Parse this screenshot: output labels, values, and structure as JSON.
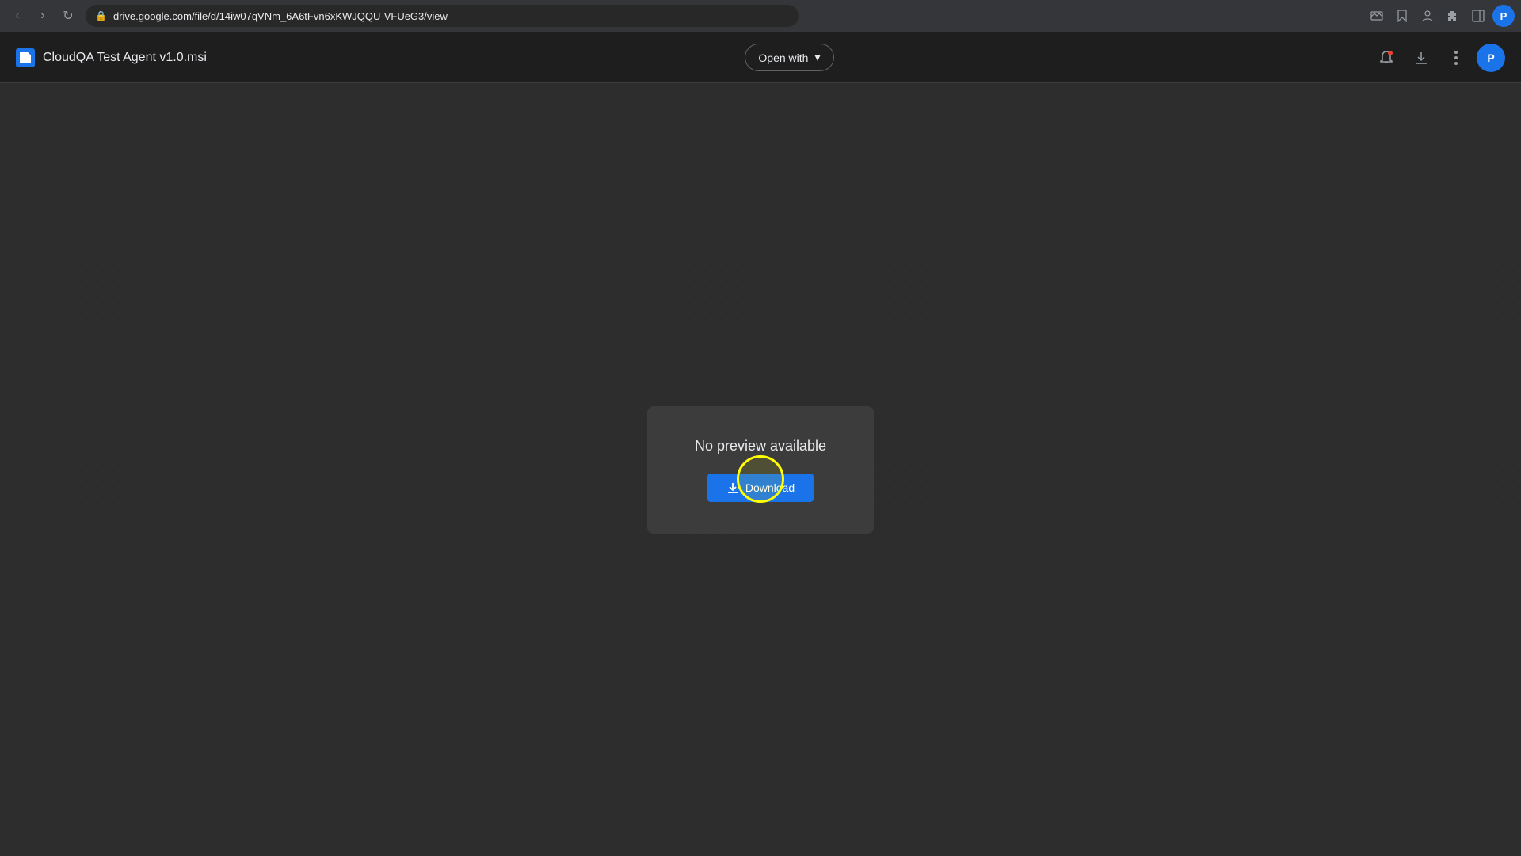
{
  "browser": {
    "url": "drive.google.com/file/d/14iw07qVNm_6A6tFvn6xKWJQQU-VFUeG3/view",
    "url_full": "drive.google.com/file/d/14iw07qVNm_6A6tFvn6xKWJQQU-VFUeG3/view",
    "back_btn_label": "‹",
    "forward_btn_label": "›",
    "refresh_btn_label": "↻",
    "profile_letter": "P"
  },
  "header": {
    "file_name": "CloudQA Test Agent v1.0.msi",
    "open_with_label": "Open with",
    "dropdown_arrow": "▾",
    "profile_letter": "P"
  },
  "main": {
    "no_preview_text": "No preview available",
    "download_label": "Download",
    "download_icon": "⬇"
  },
  "icons": {
    "lock": "🔒",
    "bell": "🔔",
    "download": "⬇",
    "more": "⋮",
    "extensions": "🧩",
    "profile_picture": "⊙",
    "screenshot": "⬡"
  }
}
